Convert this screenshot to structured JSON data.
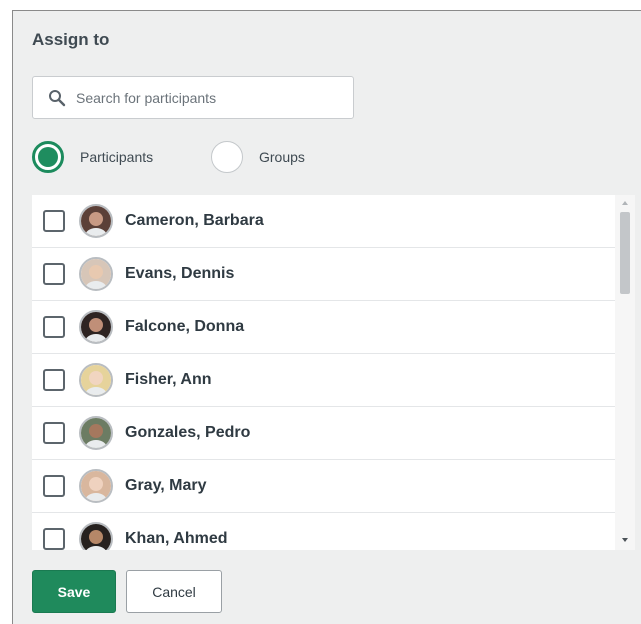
{
  "dialog": {
    "title": "Assign to"
  },
  "search": {
    "placeholder": "Search for participants",
    "value": ""
  },
  "assign_mode": {
    "options": [
      {
        "label": "Participants",
        "selected": true
      },
      {
        "label": "Groups",
        "selected": false
      }
    ]
  },
  "participants": [
    {
      "name": "Cameron, Barbara",
      "checked": false,
      "avatar_icon": "person-avatar"
    },
    {
      "name": "Evans, Dennis",
      "checked": false,
      "avatar_icon": "person-avatar"
    },
    {
      "name": "Falcone, Donna",
      "checked": false,
      "avatar_icon": "person-avatar"
    },
    {
      "name": "Fisher, Ann",
      "checked": false,
      "avatar_icon": "person-avatar"
    },
    {
      "name": "Gonzales, Pedro",
      "checked": false,
      "avatar_icon": "person-avatar"
    },
    {
      "name": "Gray, Mary",
      "checked": false,
      "avatar_icon": "person-avatar"
    },
    {
      "name": "Khan, Ahmed",
      "checked": false,
      "avatar_icon": "person-avatar"
    }
  ],
  "actions": {
    "save_label": "Save",
    "cancel_label": "Cancel"
  },
  "colors": {
    "accent": "#1f8a5c",
    "panel_background": "#eeefef",
    "text": "#2f3a42"
  },
  "icons": {
    "search": "search-icon",
    "scroll_up": "chevron-up-icon",
    "scroll_down": "chevron-down-icon"
  }
}
